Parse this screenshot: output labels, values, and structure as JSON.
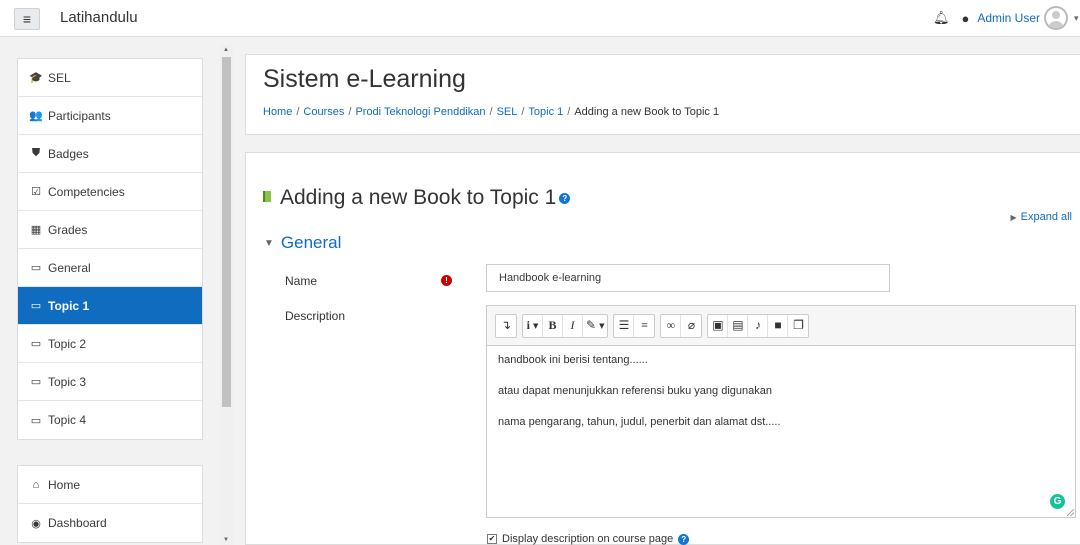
{
  "site": {
    "name": "Latihandulu",
    "user_name": "Admin User",
    "menu_icon": "hamburger-icon"
  },
  "sidebar": {
    "course_items": [
      {
        "label": "SEL",
        "icon": "graduation-cap-icon",
        "glyph": "🎓"
      },
      {
        "label": "Participants",
        "icon": "users-icon",
        "glyph": "👥"
      },
      {
        "label": "Badges",
        "icon": "shield-icon",
        "glyph": "⛊"
      },
      {
        "label": "Competencies",
        "icon": "checkbox-icon",
        "glyph": "☑"
      },
      {
        "label": "Grades",
        "icon": "table-icon",
        "glyph": "▦"
      },
      {
        "label": "General",
        "icon": "folder-icon",
        "glyph": "▭"
      },
      {
        "label": "Topic 1",
        "icon": "folder-icon",
        "glyph": "▭",
        "active": true
      },
      {
        "label": "Topic 2",
        "icon": "folder-icon",
        "glyph": "▭"
      },
      {
        "label": "Topic 3",
        "icon": "folder-icon",
        "glyph": "▭"
      },
      {
        "label": "Topic 4",
        "icon": "folder-icon",
        "glyph": "▭"
      }
    ],
    "site_items": [
      {
        "label": "Home",
        "icon": "home-icon",
        "glyph": "⌂"
      },
      {
        "label": "Dashboard",
        "icon": "dashboard-icon",
        "glyph": "◉"
      }
    ]
  },
  "header": {
    "title": "Sistem e-Learning",
    "breadcrumb": [
      "Home",
      "Courses",
      "Prodi Teknologi Penddikan",
      "SEL",
      "Topic 1"
    ],
    "breadcrumb_current": "Adding a new Book to Topic 1",
    "separator": "/"
  },
  "main": {
    "title": "Adding a new Book to Topic 1",
    "expand_all": "Expand all",
    "section": "General",
    "name_label": "Name",
    "name_value": "Handbook e-learning",
    "description_label": "Description",
    "description_paragraphs": [
      "handbook ini berisi tentang......",
      "atau dapat menunjukkan referensi buku yang digunakan",
      "nama pengarang, tahun, judul, penerbit dan alamat dst....."
    ],
    "display_description_label": "Display description on course page"
  },
  "colors": {
    "accent": "#0f6cbf",
    "required": "#cc0000",
    "book": "#8bc34a"
  }
}
